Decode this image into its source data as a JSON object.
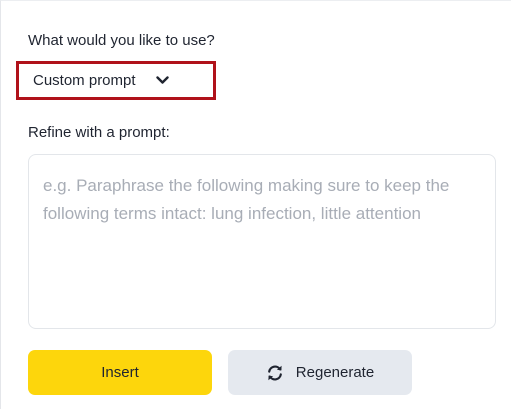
{
  "use_section": {
    "label": "What would you like to use?",
    "selected_option": "Custom prompt",
    "dropdown_icon": "chevron-down-icon"
  },
  "prompt_section": {
    "label": "Refine with a prompt:",
    "placeholder": "e.g. Paraphrase the following making sure to keep the following terms intact: lung infection, little attention",
    "value": ""
  },
  "actions": {
    "insert_label": "Insert",
    "regenerate_label": "Regenerate",
    "regenerate_icon": "refresh-icon"
  },
  "colors": {
    "highlight_border": "#b0121a",
    "insert_bg": "#fdd60c",
    "regenerate_bg": "#e5e9ef",
    "placeholder_text": "#a8adb6"
  }
}
